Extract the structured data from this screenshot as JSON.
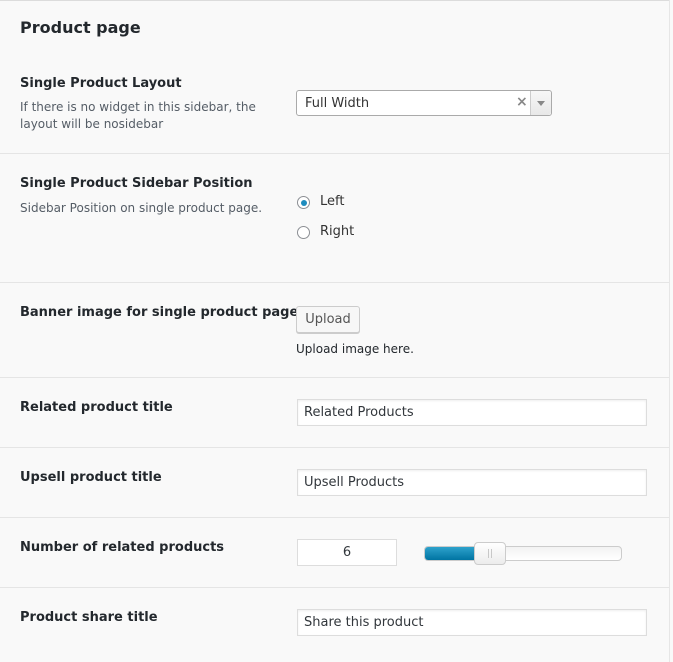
{
  "page_title": "Product page",
  "single_product_layout": {
    "title": "Single Product Layout",
    "description": "If there is no widget in this sidebar, the layout will be nosidebar",
    "selected_value": "Full Width",
    "clear_glyph": "×",
    "arrow_icon": "chevron-down-icon"
  },
  "sidebar_position": {
    "title": "Single Product Sidebar Position",
    "description": "Sidebar Position on single product page.",
    "options": [
      {
        "label": "Left",
        "checked": true
      },
      {
        "label": "Right",
        "checked": false
      }
    ]
  },
  "banner_image": {
    "title": "Banner image for single product pages",
    "upload_label": "Upload",
    "hint": "Upload image here."
  },
  "related_title": {
    "title": "Related product title",
    "value": "Related Products"
  },
  "upsell_title": {
    "title": "Upsell product title",
    "value": "Upsell Products"
  },
  "related_count": {
    "title": "Number of related products",
    "value": "6",
    "slider_fraction": 0.33
  },
  "share_title": {
    "title": "Product share title",
    "value": "Share this product"
  },
  "colors": {
    "accent": "#0074a2",
    "background": "#f9f9f9",
    "divider": "#e5e5e5"
  }
}
